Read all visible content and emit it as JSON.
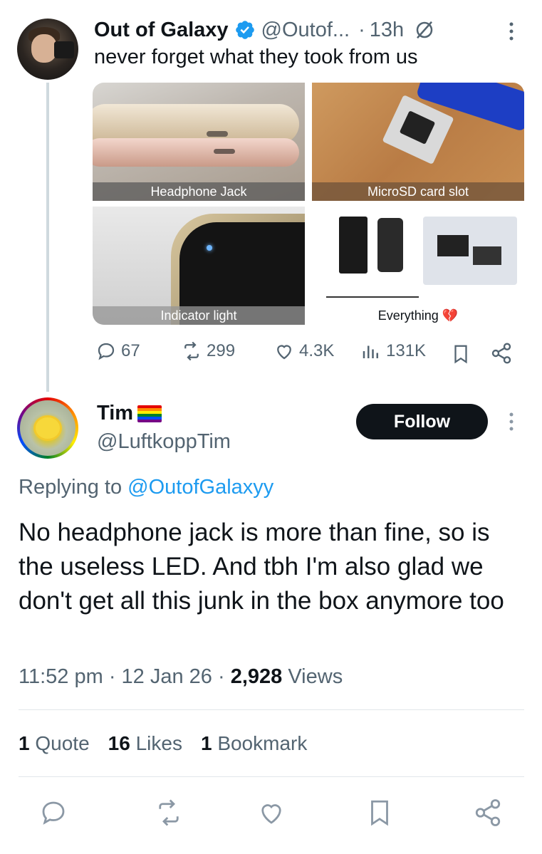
{
  "original_tweet": {
    "author_name": "Out of Galaxy",
    "author_handle": "@Outof...",
    "time": "13h",
    "text": "never forget what they took from us",
    "images": [
      {
        "caption": "Headphone Jack"
      },
      {
        "caption": "MicroSD card slot"
      },
      {
        "caption": "Indicator light"
      },
      {
        "caption": "Everything 💔"
      }
    ],
    "stats": {
      "replies": "67",
      "reposts": "299",
      "likes": "4.3K",
      "views": "131K"
    }
  },
  "reply": {
    "author_name": "Tim",
    "author_handle": "@LuftkoppTim",
    "follow_label": "Follow",
    "replying_to_prefix": "Replying to",
    "replying_to_handle": "@OutofGalaxyy",
    "text": "No headphone jack is more than fine, so is the useless LED. And tbh I'm also glad we don't get all this junk in the box anymore too",
    "time": "11:52 pm",
    "date": "12 Jan 26",
    "views_count": "2,928",
    "views_label": "Views",
    "quotes_count": "1",
    "quotes_label": "Quote",
    "likes_count": "16",
    "likes_label": "Likes",
    "bookmarks_count": "1",
    "bookmarks_label": "Bookmark"
  },
  "colors": {
    "accent": "#1d9bf0",
    "text": "#0f1419",
    "muted": "#536471",
    "follow_bg": "#0f1419"
  },
  "icons": [
    "verified-badge-icon",
    "grok-icon",
    "more-icon",
    "reply-icon",
    "repost-icon",
    "like-icon",
    "views-icon",
    "bookmark-icon",
    "share-icon",
    "rainbow-flag-icon"
  ]
}
